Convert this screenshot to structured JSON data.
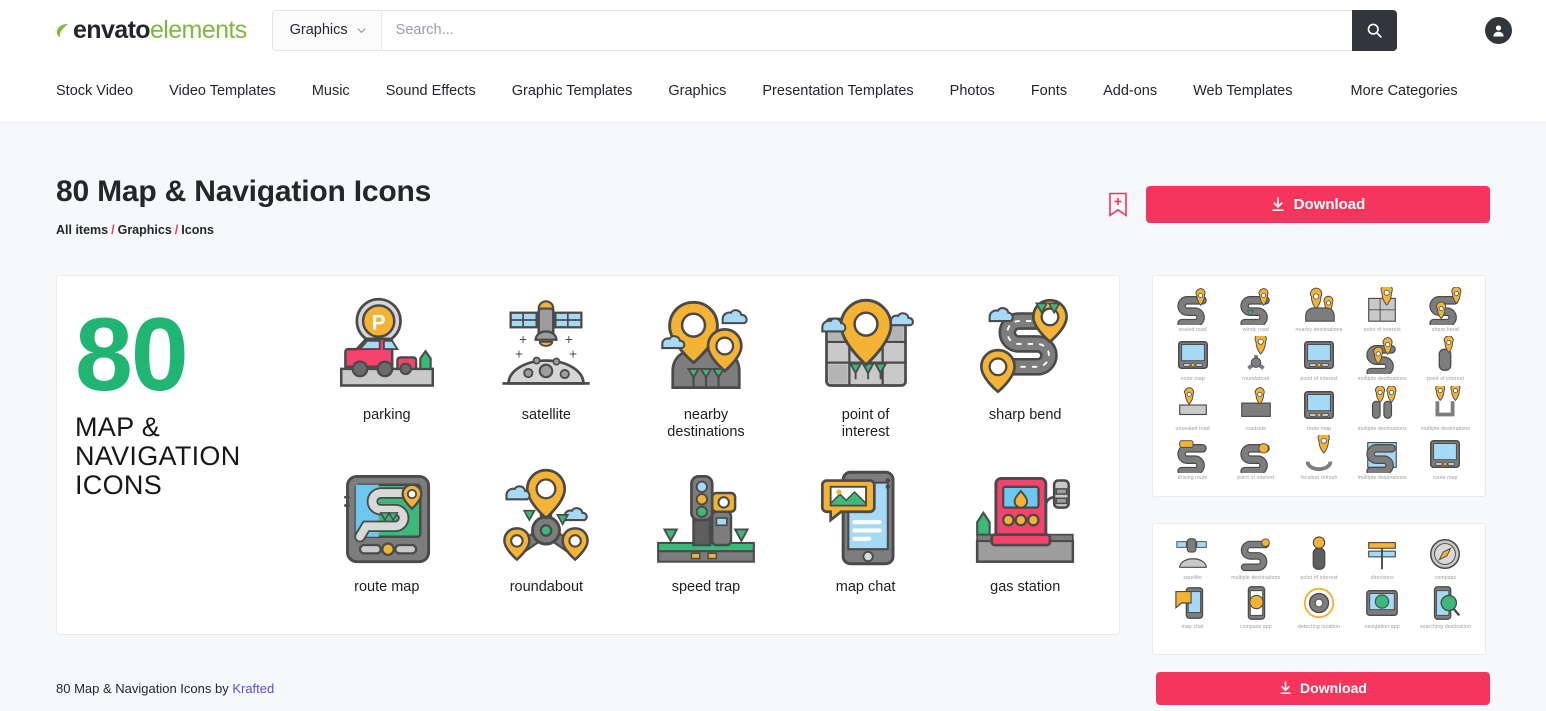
{
  "header": {
    "logo": {
      "brand": "envato",
      "product": "elements",
      "leaf_icon": "leaf-icon"
    },
    "category_select": {
      "value": "Graphics",
      "chevron_icon": "chevron-down-icon"
    },
    "search": {
      "placeholder": "Search...",
      "value": "",
      "button_icon": "search-icon"
    },
    "account": {
      "icon": "user-avatar-icon"
    }
  },
  "nav": {
    "items": [
      {
        "label": "Stock Video"
      },
      {
        "label": "Video Templates"
      },
      {
        "label": "Music"
      },
      {
        "label": "Sound Effects"
      },
      {
        "label": "Graphic Templates"
      },
      {
        "label": "Graphics"
      },
      {
        "label": "Presentation Templates"
      },
      {
        "label": "Photos"
      },
      {
        "label": "Fonts"
      },
      {
        "label": "Add-ons"
      },
      {
        "label": "Web Templates"
      }
    ],
    "more": {
      "label": "More Categories"
    }
  },
  "page": {
    "title": "80 Map & Navigation Icons",
    "breadcrumb": {
      "items": [
        "All items",
        "Graphics",
        "Icons"
      ],
      "separator": "/"
    },
    "bookmark": {
      "icon": "bookmark-plus-icon"
    },
    "download": {
      "label": "Download",
      "icon": "download-icon",
      "color": "#f4355c"
    }
  },
  "preview": {
    "hero": {
      "count": "80",
      "lines": "MAP &\nNAVIGATION\nICONS",
      "count_color": "#21b573"
    },
    "icons": [
      {
        "label": "parking",
        "art": "parking-sign-car"
      },
      {
        "label": "satellite",
        "art": "satellite-moon"
      },
      {
        "label": "nearby\ndestinations",
        "art": "two-pins-road"
      },
      {
        "label": "point of\ninterest",
        "art": "pin-city-block"
      },
      {
        "label": "sharp bend",
        "art": "s-road-pin"
      },
      {
        "label": "route map",
        "art": "gps-device-map"
      },
      {
        "label": "roundabout",
        "art": "roundabout-pins"
      },
      {
        "label": "speed trap",
        "art": "traffic-light-camera"
      },
      {
        "label": "map chat",
        "art": "phone-map-chat"
      },
      {
        "label": "gas station",
        "art": "fuel-pump"
      }
    ]
  },
  "thumbnails": [
    {
      "name": "preview-grid-1",
      "cells": [
        {
          "label": "sealed road"
        },
        {
          "label": "windy road"
        },
        {
          "label": "nearby destinations"
        },
        {
          "label": "point of interest"
        },
        {
          "label": "sharp bend"
        },
        {
          "label": "route map"
        },
        {
          "label": "roundabout"
        },
        {
          "label": "point of interest"
        },
        {
          "label": "multiple destinations"
        },
        {
          "label": "point of interest"
        },
        {
          "label": "unsealed road"
        },
        {
          "label": "roadside"
        },
        {
          "label": "route map"
        },
        {
          "label": "multiple destinations"
        },
        {
          "label": "multiple destinations"
        },
        {
          "label": "driving route"
        },
        {
          "label": "point of interest"
        },
        {
          "label": "location refresh"
        },
        {
          "label": "multiple destinations"
        },
        {
          "label": "route map"
        }
      ]
    },
    {
      "name": "preview-grid-2",
      "cells": [
        {
          "label": "satellite"
        },
        {
          "label": "multiple destinations"
        },
        {
          "label": "point of interest"
        },
        {
          "label": "directions"
        },
        {
          "label": "compass"
        },
        {
          "label": "map chat"
        },
        {
          "label": "compass app"
        },
        {
          "label": "detecting location"
        },
        {
          "label": "navigation app"
        },
        {
          "label": "searching destination"
        }
      ]
    }
  ],
  "footer": {
    "attribution_prefix": "80 Map & Navigation Icons by ",
    "author": "Krafted",
    "download": {
      "label": "Download",
      "icon": "download-icon"
    }
  },
  "colors": {
    "accent": "#f4355c",
    "brand_green": "#82b541",
    "hero_green": "#21b573",
    "link": "#5b4de0",
    "icon_yellow": "#f5b335",
    "icon_pink": "#f4436c",
    "icon_blue": "#a6d9f5",
    "icon_gray": "#c9c9c9",
    "icon_outline": "#4a4a4a",
    "icon_green": "#3cb878",
    "page_bg": "#f7f8fa"
  }
}
